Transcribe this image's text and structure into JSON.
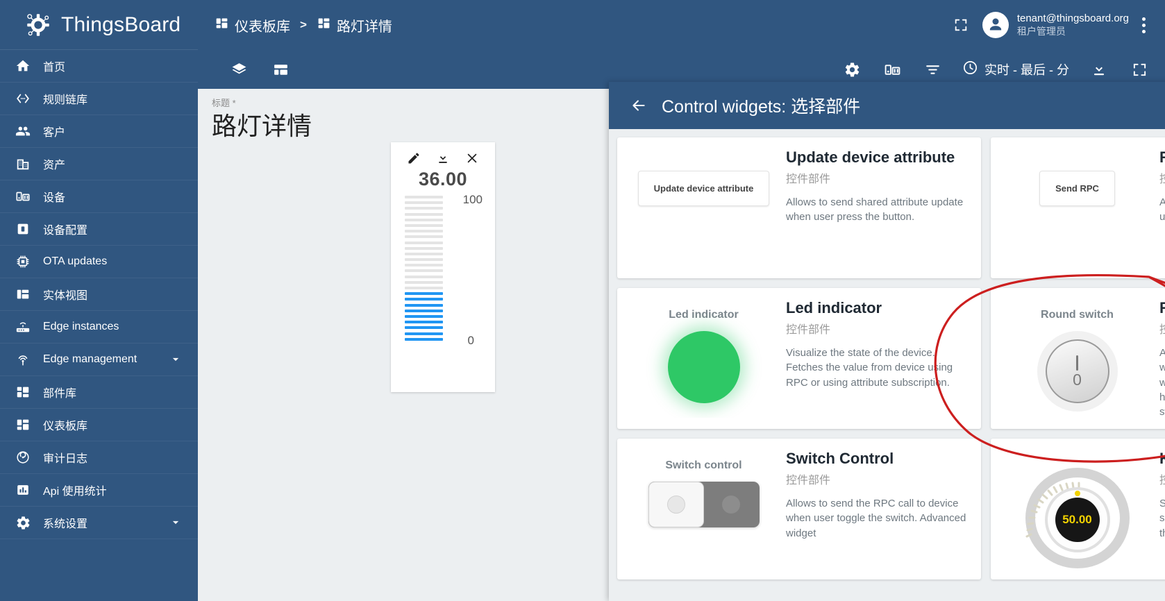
{
  "brand": {
    "name": "ThingsBoard",
    "logo_icon": "thingsboard-logo-icon",
    "accent": "#305680"
  },
  "sidebar": {
    "items": [
      {
        "label": "首页",
        "icon": "home-icon",
        "expandable": false
      },
      {
        "label": "规则链库",
        "icon": "rule-chain-icon",
        "expandable": false
      },
      {
        "label": "客户",
        "icon": "customers-icon",
        "expandable": false
      },
      {
        "label": "资产",
        "icon": "assets-icon",
        "expandable": false
      },
      {
        "label": "设备",
        "icon": "devices-icon",
        "expandable": false
      },
      {
        "label": "设备配置",
        "icon": "device-profile-icon",
        "expandable": false
      },
      {
        "label": "OTA updates",
        "icon": "ota-updates-icon",
        "expandable": false
      },
      {
        "label": "实体视图",
        "icon": "entity-view-icon",
        "expandable": false
      },
      {
        "label": "Edge instances",
        "icon": "edge-instance-icon",
        "expandable": false
      },
      {
        "label": "Edge management",
        "icon": "edge-management-icon",
        "expandable": true
      },
      {
        "label": "部件库",
        "icon": "widget-library-icon",
        "expandable": false
      },
      {
        "label": "仪表板库",
        "icon": "dashboard-library-icon",
        "expandable": false
      },
      {
        "label": "审计日志",
        "icon": "audit-log-icon",
        "expandable": false
      },
      {
        "label": "Api 使用统计",
        "icon": "api-usage-icon",
        "expandable": false
      },
      {
        "label": "系统设置",
        "icon": "settings-icon",
        "expandable": true
      }
    ]
  },
  "topbar": {
    "breadcrumb": [
      {
        "label": "仪表板库",
        "icon": "dashboard-library-icon"
      },
      {
        "label": "路灯详情",
        "icon": "dashboard-icon"
      }
    ],
    "separator": ">",
    "fullscreen_icon": "fullscreen-icon",
    "user": {
      "email": "tenant@thingsboard.org",
      "role": "租户管理员",
      "avatar_icon": "account-circle-icon"
    },
    "more_icon": "more-vertical-icon"
  },
  "dashboard_toolbar": {
    "left_icons": [
      {
        "name": "layers-icon"
      },
      {
        "name": "dashboard-layout-icon"
      }
    ],
    "right_icons": [
      {
        "name": "gear-icon"
      },
      {
        "name": "device-state-icon"
      },
      {
        "name": "filter-icon"
      }
    ],
    "timerange": {
      "icon": "clock-icon",
      "label": "实时 - 最后 - 分"
    },
    "export_icon": "download-icon",
    "fullscreen_icon": "fullscreen-icon"
  },
  "dashboard": {
    "title_label": "标题 *",
    "title": "路灯详情",
    "gauge_widget": {
      "actions": [
        {
          "name": "edit-icon"
        },
        {
          "name": "download-icon"
        },
        {
          "name": "close-icon"
        }
      ],
      "value": "36.00",
      "max_label": "100",
      "min_label": "0",
      "max": 100,
      "min": 0,
      "bar_color": "#2196f3",
      "inactive_color": "#e4e4e4",
      "total_bars": 26,
      "filled_bars": 9
    }
  },
  "panel": {
    "back_icon": "arrow-left-icon",
    "title": "Control widgets: 选择部件",
    "search_icon": "search-icon",
    "close_icon": "close-icon",
    "widgets": [
      {
        "title": "Update device attribute",
        "subtitle": "控件部件",
        "description": "Allows to send shared attribute update when user press the button.",
        "preview_type": "button",
        "preview_label": "Update device attribute",
        "highlighted": false
      },
      {
        "title": "RPC Button",
        "subtitle": "控件部件",
        "description": "Allows to send RPC command when user press the button.",
        "preview_type": "button",
        "preview_label": "Send RPC",
        "highlighted": false
      },
      {
        "title": "Led indicator",
        "subtitle": "控件部件",
        "description": "Visualize the state of the device. Fetches the value from device using RPC or using attribute subscription.",
        "preview_type": "led",
        "preview_label": "Led indicator",
        "preview_color": "#2ec866",
        "highlighted": false
      },
      {
        "title": "Round switch",
        "subtitle": "控件部件",
        "description": "Allows to send the RPC call to device when user toggle the switch. Advanced widget settings allow you to configure how to fetch the initial value of the switch.",
        "preview_type": "round-switch",
        "preview_label": "Round switch",
        "preview_on_label": "I",
        "preview_off_label": "0",
        "highlighted": true
      },
      {
        "title": "Switch Control",
        "subtitle": "控件部件",
        "description": "Allows to send the RPC call to device when user toggle the switch. Advanced widget",
        "preview_type": "toggle",
        "preview_label": "Switch control",
        "highlighted": false
      },
      {
        "title": "Knob Control",
        "subtitle": "控件部件",
        "description": "Sends the command to device with specified value each time user changes the value. Uses",
        "preview_type": "knob",
        "preview_label": "",
        "preview_value": "50.00",
        "highlighted": false
      }
    ]
  },
  "annotation": {
    "type": "hand-drawn-ellipse",
    "color": "#cc1f1f",
    "target": "Round switch"
  }
}
